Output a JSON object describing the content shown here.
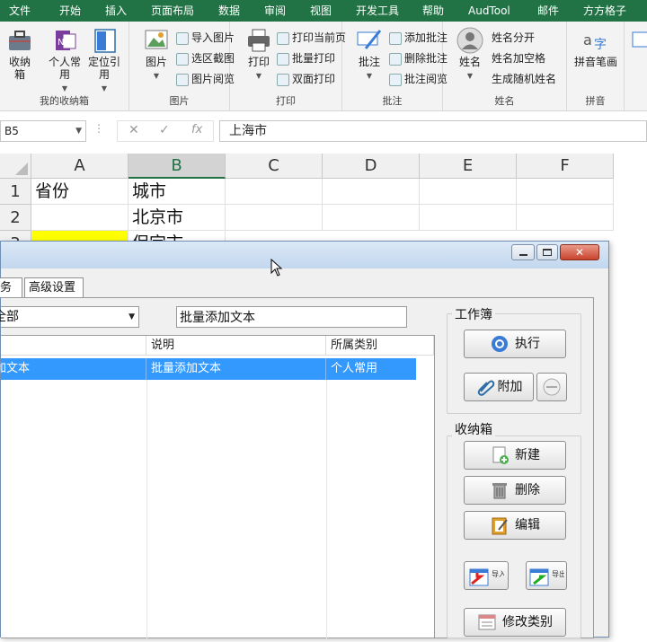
{
  "ribbon": {
    "tabs": [
      "文件",
      "开始",
      "插入",
      "页面布局",
      "数据",
      "审阅",
      "视图",
      "开发工具",
      "帮助",
      "AudTool",
      "邮件",
      "方方格子"
    ],
    "groups": {
      "shounaxiang": {
        "label": "我的收纳箱",
        "btn_shounaxiang": "收纳箱",
        "btn_personal": "个人常用",
        "btn_locate": "定位引用"
      },
      "picture": {
        "label": "图片",
        "btn_picture": "图片",
        "import": "导入图片",
        "screenshot": "选区截图",
        "browse": "图片阅览"
      },
      "print": {
        "label": "打印",
        "btn_print": "打印",
        "current": "打印当前页",
        "batch": "批量打印",
        "duplex": "双面打印"
      },
      "comment": {
        "label": "批注",
        "btn_comment": "批注",
        "add": "添加批注",
        "delete": "删除批注",
        "browse": "批注阅览"
      },
      "name": {
        "label": "姓名",
        "btn_name": "姓名",
        "split": "姓名分开",
        "space": "姓名加空格",
        "random": "生成随机姓名"
      },
      "pinyin": {
        "label": "拼音",
        "btn_pinyin": "拼音笔画"
      }
    }
  },
  "formula_bar": {
    "name_box": "B5",
    "content": "上海市"
  },
  "sheet": {
    "columns": [
      "A",
      "B",
      "C",
      "D",
      "E",
      "F"
    ],
    "rows": [
      "1",
      "2",
      "3"
    ],
    "cells": {
      "A1": "省份",
      "B1": "城市",
      "B2": "北京市",
      "B3": "保定市"
    },
    "colors": {
      "highlight": "#ffff00",
      "header_selected": "#217346"
    }
  },
  "dialog": {
    "tabs": [
      "务",
      "高级设置"
    ],
    "category_value": "全部",
    "search_value": "批量添加文本",
    "list": {
      "headers": [
        "",
        "说明",
        "所属类别"
      ],
      "rows": [
        {
          "name": "加文本",
          "desc": "批量添加文本",
          "category": "个人常用"
        }
      ]
    },
    "workbook": {
      "legend": "工作簿",
      "execute": "执行",
      "attach": "附加"
    },
    "storage": {
      "legend": "收纳箱",
      "new": "新建",
      "delete": "删除",
      "edit": "编辑",
      "import": "导入",
      "export": "导出",
      "modify_category": "修改类别"
    }
  }
}
